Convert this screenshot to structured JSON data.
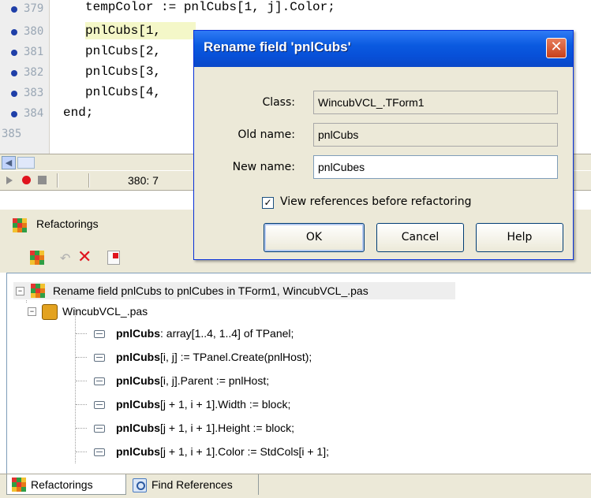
{
  "editor": {
    "gutter_lines": [
      "379",
      "380",
      "381",
      "382",
      "383",
      "384",
      "385"
    ],
    "code_lines": [
      "tempColor := pnlCubs[1, j].Color;",
      "pnlCubs[1,",
      "pnlCubs[2,",
      "pnlCubs[3,",
      "pnlCubs[4,",
      "end;"
    ]
  },
  "status_bar": {
    "cursor_position": "380:  7"
  },
  "panel": {
    "title": "Refactorings",
    "tree": {
      "root": "Rename field pnlCubs to pnlCubes in TForm1, WincubVCL_.pas",
      "file": "WincubVCL_.pas",
      "references": [
        {
          "bold": "pnlCubs",
          "rest": ": array[1..4, 1..4] of TPanel;"
        },
        {
          "bold": "pnlCubs",
          "rest": "[i, j] := TPanel.Create(pnlHost);"
        },
        {
          "bold": "pnlCubs",
          "rest": "[i, j].Parent := pnlHost;"
        },
        {
          "bold": "pnlCubs",
          "rest": "[j + 1, i + 1].Width := block;"
        },
        {
          "bold": "pnlCubs",
          "rest": "[j + 1, i + 1].Height := block;"
        },
        {
          "bold": "pnlCubs",
          "rest": "[j + 1, i + 1].Color := StdCols[i + 1];"
        }
      ]
    },
    "tabs": [
      "Refactorings",
      "Find References"
    ]
  },
  "dialog": {
    "title": "Rename field 'pnlCubs'",
    "class_label": "Class:",
    "class_value": "WincubVCL_.TForm1",
    "old_name_label": "Old name:",
    "old_name_value": "pnlCubs",
    "new_name_label": "New name:",
    "new_name_value": "pnlCubes",
    "checkbox_label": "View references before refactoring",
    "checkbox_checked": true,
    "ok_label": "OK",
    "cancel_label": "Cancel",
    "help_label": "Help",
    "close_glyph": "✕"
  },
  "colors": {
    "title_bar": "#0a5ae0",
    "close_button": "#c8401b",
    "highlight_line": "#f4f7c8",
    "breakpoint": "#e0141e"
  }
}
